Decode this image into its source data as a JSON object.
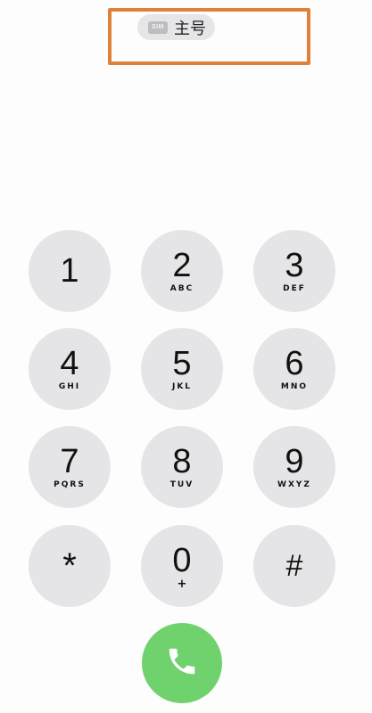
{
  "sim": {
    "badge": "SIM",
    "label": "主号"
  },
  "keypad": {
    "keys": [
      {
        "digit": "1",
        "letters": ""
      },
      {
        "digit": "2",
        "letters": "ABC"
      },
      {
        "digit": "3",
        "letters": "DEF"
      },
      {
        "digit": "4",
        "letters": "GHI"
      },
      {
        "digit": "5",
        "letters": "JKL"
      },
      {
        "digit": "6",
        "letters": "MNO"
      },
      {
        "digit": "7",
        "letters": "PQRS"
      },
      {
        "digit": "8",
        "letters": "TUV"
      },
      {
        "digit": "9",
        "letters": "WXYZ"
      },
      {
        "digit": "*",
        "letters": ""
      },
      {
        "digit": "0",
        "letters": "+"
      },
      {
        "digit": "#",
        "letters": ""
      }
    ]
  },
  "colors": {
    "key_bg": "#e5e5e7",
    "call_green": "#6fd26d",
    "highlight_orange": "#e0813a"
  },
  "icons": {
    "call": "phone-icon",
    "sim": "sim-card-icon"
  }
}
